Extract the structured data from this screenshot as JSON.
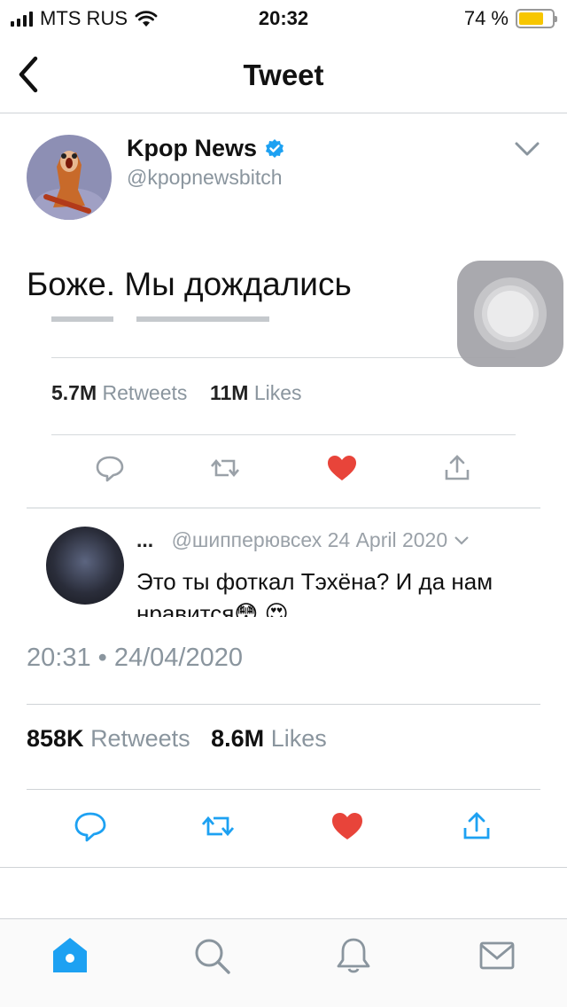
{
  "status_bar": {
    "carrier": "MTS RUS",
    "time": "20:32",
    "battery_percent": "74 %",
    "battery_level": 0.74,
    "icons": [
      "signal-icon",
      "wifi-icon",
      "battery-icon"
    ]
  },
  "nav": {
    "title": "Tweet",
    "back_icon": "chevron-left-icon"
  },
  "tweet": {
    "author_name": "Kpop News",
    "author_handle": "@kpopnewsbitch",
    "verified_icon": "verified-badge-icon",
    "text": "Боже. Мы дождались",
    "timestamp": "20:31 • 24/04/2020",
    "retweets_count": "858K",
    "retweets_label": "Retweets",
    "likes_count": "8.6M",
    "likes_label": "Likes"
  },
  "embedded_image": {
    "retweets_count": "5.7M",
    "retweets_label": "Retweets",
    "likes_count": "11M",
    "likes_label": "Likes",
    "reply_dots": "...",
    "reply_handle": "@шипперювсех",
    "reply_date": "24 April 2020",
    "reply_text": "Это ты фоткал Тэхёна? И да нам нравится😳 😍"
  },
  "actions": [
    "reply-icon",
    "retweet-icon",
    "like-icon",
    "share-icon"
  ],
  "tabbar": [
    "home-icon",
    "search-icon",
    "notifications-icon",
    "messages-icon"
  ],
  "colors": {
    "accent": "#1da1f2",
    "like_red": "#e0245e",
    "secondary_text": "#8a959e"
  }
}
